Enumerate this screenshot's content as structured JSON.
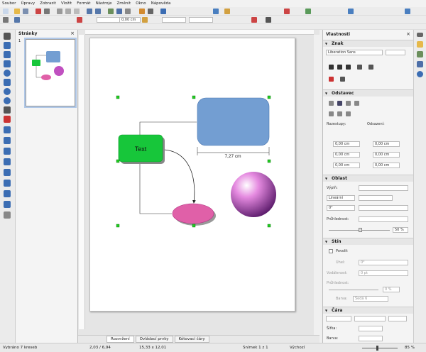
{
  "menu": [
    "Soubor",
    "Úpravy",
    "Zobrazit",
    "Vložit",
    "Formát",
    "Nástroje",
    "Změnit",
    "Okno",
    "Nápověda"
  ],
  "toolbar": {
    "line_width": "0,00 cm"
  },
  "slides_panel": {
    "title": "Stránky",
    "close": "×",
    "slide_number": "1"
  },
  "drawing": {
    "text_shape_label": "Text",
    "dimension_label": "7,27 cm"
  },
  "page_tabs": [
    "Rozvržení",
    "Ovládací prvky",
    "Kótovací čáry"
  ],
  "properties": {
    "title": "Vlastnosti",
    "close": "×",
    "character": {
      "title": "Znak",
      "font": "Liberation Sans"
    },
    "paragraph": {
      "title": "Odstavec",
      "spacing_label": "Rozestupy:",
      "indent_label": "Odsazení:",
      "v1": "0,00 cm",
      "v2": "0,00 cm",
      "v3": "0,00 cm",
      "v4": "0,00 cm",
      "v5": "0,00 cm",
      "v6": "0,00 cm"
    },
    "area": {
      "title": "Oblast",
      "fill_label": "Výplň:",
      "fill_type": "Lineární",
      "angle": "0°",
      "transparency_label": "Průhlednost:",
      "transparency_value": "50 %"
    },
    "shadow": {
      "title": "Stín",
      "enable_label": "Povolit",
      "angle_label": "Úhel:",
      "angle_value": "0°",
      "distance_label": "Vzdálenost:",
      "distance_value": "0 pt",
      "transparency_label": "Průhlednost:",
      "transparency_value": "0 %",
      "color_label": "Barva:",
      "color_value": "Šedá 6"
    },
    "line": {
      "title": "Čára",
      "width_label": "Šířka:",
      "color_label": "Barva:"
    }
  },
  "status": {
    "selection": "Vybráno 7 kreseb",
    "position": "2,03 / 6,94",
    "size": "15,33 x 12,01",
    "slide": "Snímek 1 z 1",
    "page_style": "Výchozí",
    "zoom": "85 %"
  },
  "colors": {
    "accent": "#b0c8e8",
    "green_shape": "#17c63a",
    "blue_shape": "#739ed2",
    "pink_shape": "#e060a8"
  }
}
